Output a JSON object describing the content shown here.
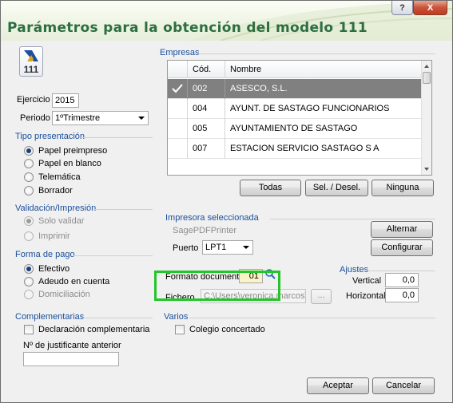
{
  "window": {
    "title": "Parámetros para la obtención del modelo 111",
    "help_label": "?",
    "close_label": "X"
  },
  "logo": {
    "text": "111"
  },
  "ejercicio": {
    "label": "Ejercicio",
    "value": "2015"
  },
  "periodo": {
    "label": "Periodo",
    "value": "1ºTrimestre"
  },
  "tipo_presentacion": {
    "title": "Tipo presentación",
    "options": [
      "Papel preimpreso",
      "Papel en blanco",
      "Telemática",
      "Borrador"
    ],
    "selected": 0
  },
  "validacion": {
    "title": "Validación/Impresión",
    "options": [
      "Solo validar",
      "Imprimir"
    ]
  },
  "forma_pago": {
    "title": "Forma de pago",
    "options": [
      "Efectivo",
      "Adeudo en cuenta",
      "Domiciliación"
    ]
  },
  "complementarias": {
    "title": "Complementarias",
    "checkbox_label": "Declaración complementaria",
    "justificante_label": "Nº de justificante anterior",
    "justificante_value": ""
  },
  "empresas": {
    "title": "Empresas",
    "columns": [
      "Cód.",
      "Nombre"
    ],
    "rows": [
      {
        "code": "002",
        "name": "ASESCO, S.L.",
        "selected": true
      },
      {
        "code": "004",
        "name": "AYUNT. DE SASTAGO FUNCIONARIOS",
        "selected": false
      },
      {
        "code": "005",
        "name": "AYUNTAMIENTO DE SASTAGO",
        "selected": false
      },
      {
        "code": "007",
        "name": "ESTACION SERVICIO SASTAGO S A",
        "selected": false
      }
    ],
    "buttons": {
      "todas": "Todas",
      "sel_desel": "Sel. / Desel.",
      "ninguna": "Ninguna"
    }
  },
  "impresora": {
    "title": "Impresora seleccionada",
    "printer_name": "SagePDFPrinter",
    "alternar": "Alternar",
    "puerto_label": "Puerto",
    "puerto_value": "LPT1",
    "configurar": "Configurar"
  },
  "formato": {
    "label": "Formato documento",
    "value": "01"
  },
  "fichero": {
    "label": "Fichero",
    "value": "C:\\Users\\veronica.marcos\\Do",
    "browse": "..."
  },
  "ajustes": {
    "title": "Ajustes",
    "vertical_label": "Vertical",
    "vertical_value": "0,0",
    "horizontal_label": "Horizontal",
    "horizontal_value": "0,0"
  },
  "varios": {
    "title": "Varios",
    "checkbox_label": "Colegio concertado"
  },
  "footer": {
    "aceptar": "Aceptar",
    "cancelar": "Cancelar"
  },
  "colors": {
    "section_title": "#1a4f9c",
    "window_title": "#2d6e41",
    "highlight": "#22c52a",
    "selected_row": "#808080"
  }
}
